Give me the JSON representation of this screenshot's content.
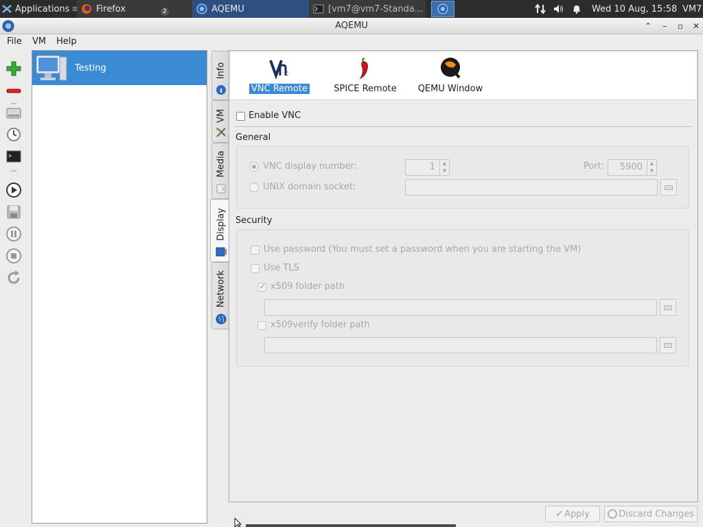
{
  "panel": {
    "applications": "Applications",
    "tasks": [
      {
        "label": "Firefox",
        "badge": "2"
      },
      {
        "label": "AQEMU"
      },
      {
        "label": "[vm7@vm7-Standa..."
      }
    ],
    "clock": "Wed 10 Aug, 15:58",
    "user": "VM7"
  },
  "window": {
    "title": "AQEMU"
  },
  "menu": {
    "file": "File",
    "vm": "VM",
    "help": "Help"
  },
  "vm_list": {
    "items": [
      {
        "label": "Testing"
      }
    ]
  },
  "tabs": [
    {
      "label": "Info"
    },
    {
      "label": "VM"
    },
    {
      "label": "Media"
    },
    {
      "label": "Display"
    },
    {
      "label": "Network"
    }
  ],
  "display_modes": [
    {
      "label": "VNC Remote",
      "selected": true
    },
    {
      "label": "SPICE Remote",
      "selected": false
    },
    {
      "label": "QEMU Window",
      "selected": false
    }
  ],
  "vnc": {
    "enable_label": "Enable VNC",
    "general_label": "General",
    "display_number_label": "VNC display number:",
    "display_number_value": "1",
    "port_label": "Port:",
    "port_value": "5900",
    "unix_socket_label": "UNIX domain socket:",
    "unix_socket_value": "",
    "security_label": "Security",
    "use_password_label": "Use password (You must set a password when you are starting the VM)",
    "use_tls_label": "Use TLS",
    "x509_folder_label": "x509 folder path",
    "x509_folder_value": "",
    "x509verify_folder_label": "x509verify folder path",
    "x509verify_folder_value": ""
  },
  "buttons": {
    "apply": "Apply",
    "discard": "Discard Changes"
  },
  "colors": {
    "selection": "#3b8ad4",
    "panel": "#2c2c2c",
    "active_task": "#2d4f82"
  }
}
